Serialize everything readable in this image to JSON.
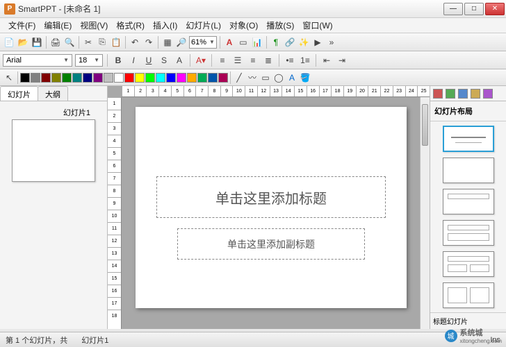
{
  "app": {
    "icon_letter": "P",
    "title": "SmartPPT - [未命名 1]"
  },
  "winbtns": {
    "min": "—",
    "max": "□",
    "close": "✕"
  },
  "menus": [
    "文件(F)",
    "编辑(E)",
    "视图(V)",
    "格式(R)",
    "插入(I)",
    "幻灯片(L)",
    "对象(O)",
    "播放(S)",
    "窗口(W)"
  ],
  "zoom": "61%",
  "font": {
    "name": "Arial",
    "size": "18"
  },
  "swatches": [
    "#000",
    "#808080",
    "#800000",
    "#808000",
    "#008000",
    "#008080",
    "#000080",
    "#800080",
    "#c0c0c0",
    "#fff",
    "#f00",
    "#ff0",
    "#0f0",
    "#0ff",
    "#00f",
    "#f0f",
    "#fa0",
    "#0a5",
    "#05a",
    "#a05"
  ],
  "tabs": {
    "slides": "幻灯片",
    "outline": "大纲"
  },
  "thumb_label": "幻灯片1",
  "slide": {
    "title_placeholder": "单击这里添加标题",
    "subtitle_placeholder": "单击这里添加副标题"
  },
  "right": {
    "title": "幻灯片布局",
    "footer": "标题幻灯片"
  },
  "status": {
    "pos": "第 1 个幻灯片，共",
    "name": "幻灯片1",
    "ins": "Ins"
  },
  "ruler_h": [
    1,
    2,
    3,
    4,
    5,
    6,
    7,
    8,
    9,
    10,
    11,
    12,
    13,
    14,
    15,
    16,
    17,
    18,
    19,
    20,
    21,
    22,
    23,
    24,
    25
  ],
  "ruler_v": [
    1,
    2,
    3,
    4,
    5,
    6,
    7,
    8,
    9,
    10,
    11,
    12,
    13,
    14,
    15,
    16,
    17,
    18
  ],
  "watermark": {
    "text": "系统城",
    "url": "xitongcheng.com"
  }
}
